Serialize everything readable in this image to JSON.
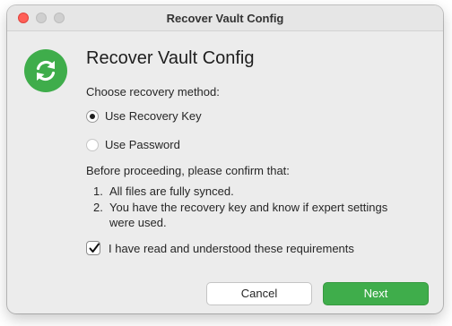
{
  "window": {
    "title": "Recover Vault Config"
  },
  "dialog": {
    "heading": "Recover Vault Config",
    "choose_label": "Choose recovery method:",
    "options": [
      {
        "label": "Use Recovery Key",
        "selected": true
      },
      {
        "label": "Use Password",
        "selected": false
      }
    ],
    "confirm_intro": "Before proceeding, please confirm that:",
    "requirements": [
      {
        "number": "1.",
        "lines": [
          "All files are fully synced."
        ]
      },
      {
        "number": "2.",
        "lines": [
          "You have the recovery key and know if expert settings",
          "were used."
        ]
      }
    ],
    "checkbox": {
      "label": "I have read and understood these requirements",
      "checked": true
    }
  },
  "buttons": {
    "cancel_label": "Cancel",
    "next_label": "Next"
  },
  "colors": {
    "accent": "#3fad4b",
    "close": "#ff5f57"
  },
  "icons": {
    "app": "sync-arrows-icon",
    "check": "checkmark-icon"
  }
}
